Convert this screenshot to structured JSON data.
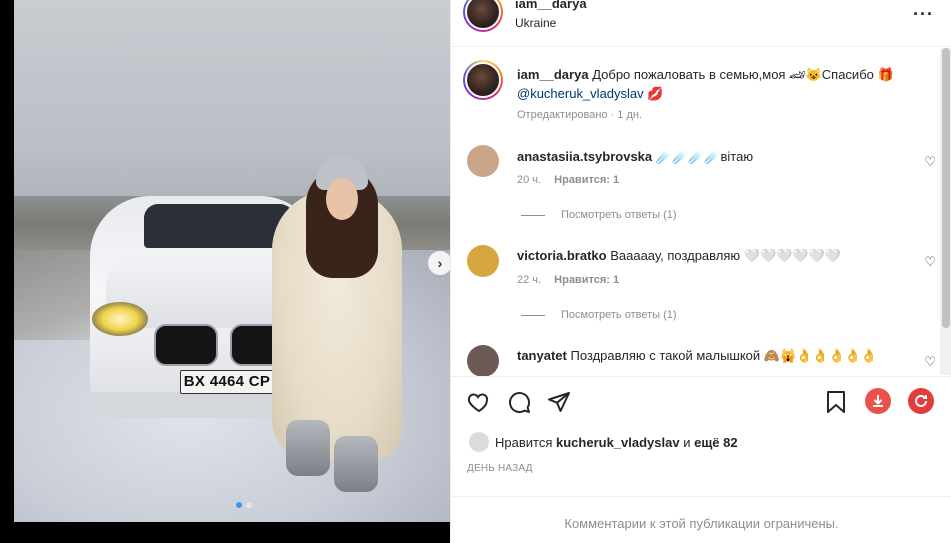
{
  "post": {
    "plate_text": "BX 4464 CP",
    "carousel": {
      "count": 2,
      "active_index": 0
    }
  },
  "header": {
    "username": "iam__darya",
    "location": "Ukraine"
  },
  "caption": {
    "username": "iam__darya",
    "text": "Добро пожаловать в семью,моя 🏎😺Спасибо 🎁",
    "mention": "@kucheruk_vladyslav",
    "emoji_end": "💋",
    "meta": "Отредактировано · 1 дн."
  },
  "comments": [
    {
      "username": "anastasiia.tsybrovska",
      "text": "☄️☄️☄️☄️вітаю",
      "time": "20 ч.",
      "likes": "Нравится: 1",
      "replies": "Посмотреть ответы (1)",
      "avatar_color": "#c9a689"
    },
    {
      "username": "victoria.bratko",
      "text": "Вааааау, поздравляю 🤍🤍🤍🤍🤍🤍",
      "time": "22 ч.",
      "likes": "Нравится: 1",
      "replies": "Посмотреть ответы (1)",
      "avatar_color": "#d8a640"
    },
    {
      "username": "tanyatet",
      "text": "Поздравляю с такой малышкой 🙈🙀👌👌👌👌👌",
      "avatar_color": "#6b5a55"
    }
  ],
  "likes": {
    "prefix": "Нравится",
    "user": "kucheruk_vladyslav",
    "joiner": "и",
    "rest": "ещё 82"
  },
  "date_label": "ДЕНЬ НАЗАД",
  "comments_limited": "Комментарии к этой публикации ограничены.",
  "colors": {
    "accent": "#3897f0",
    "download_red": "#e9524a",
    "refresh_red": "#e23d3d"
  }
}
